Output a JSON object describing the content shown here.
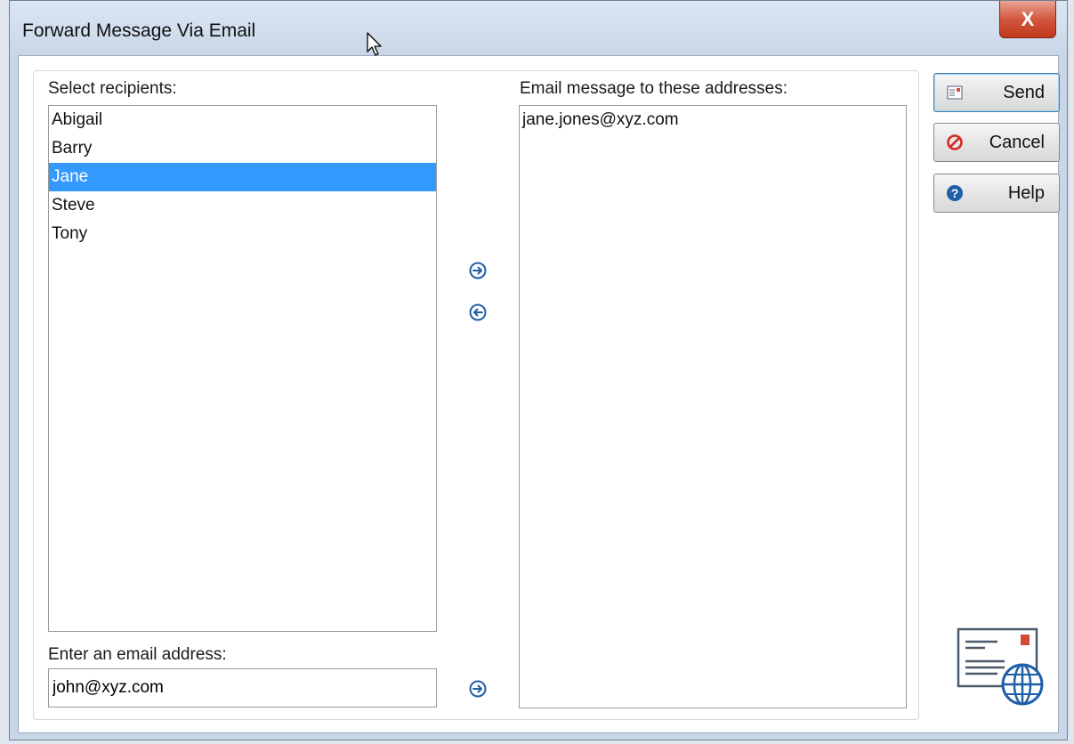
{
  "window": {
    "title": "Forward Message Via Email",
    "close_glyph": "X"
  },
  "recipients": {
    "label": "Select recipients:",
    "items": [
      "Abigail",
      "Barry",
      "Jane",
      "Steve",
      "Tony"
    ],
    "selected": "Jane"
  },
  "addresses": {
    "label": "Email message to these addresses:",
    "items": [
      "jane.jones@xyz.com"
    ]
  },
  "email_entry": {
    "label": "Enter an email address:",
    "value": "john@xyz.com"
  },
  "actions": {
    "send": "Send",
    "cancel": "Cancel",
    "help": "Help"
  },
  "icons": {
    "add": "arrow-right-circle-icon",
    "remove": "arrow-left-circle-icon",
    "add_address": "arrow-right-circle-icon",
    "send": "send-icon",
    "cancel": "no-entry-icon",
    "help": "question-circle-icon",
    "illustration": "email-globe-icon"
  },
  "colors": {
    "selection": "#3399ff",
    "help_blue": "#1f5fa8",
    "cancel_red": "#d42a1e",
    "close_red": "#c9452a"
  }
}
